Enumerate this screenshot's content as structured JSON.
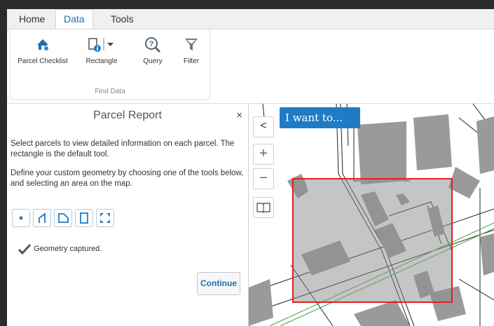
{
  "tabs": [
    "Home",
    "Data",
    "Tools"
  ],
  "ribbon": {
    "buttons": [
      "Parcel Checklist",
      "Rectangle",
      "Query",
      "Filter"
    ],
    "group_label": "Find Data"
  },
  "panel": {
    "title": "Parcel Report",
    "close": "×",
    "intro": "Select parcels to view detailed information on each parcel. The rectangle is the default tool.",
    "instructions": "Define your custom geometry by choosing one of the tools below, and selecting an area on the map.",
    "tools": [
      "point-icon",
      "polyline-icon",
      "polygon-icon",
      "rectangle-icon",
      "extent-icon"
    ],
    "status": "Geometry captured.",
    "continue_label": "Continue"
  },
  "map": {
    "collapse": "<",
    "i_want_to": "I want to...",
    "zoom_in": "+",
    "zoom_out": "−",
    "selection_color": "#e02020"
  },
  "colors": {
    "accent": "#1f7bc4",
    "panel_border": "#cfcfcf"
  }
}
